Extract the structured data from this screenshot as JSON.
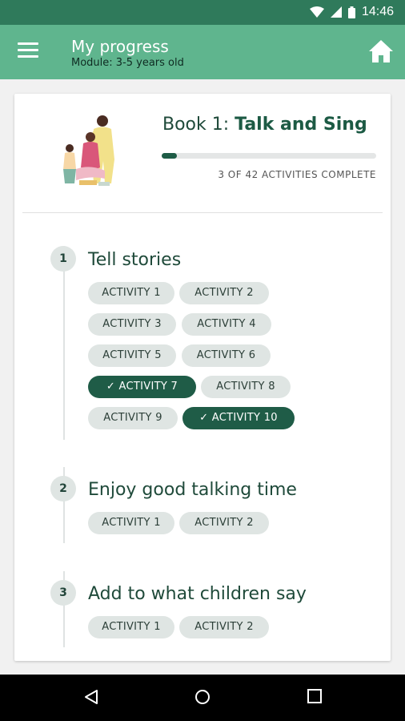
{
  "status_bar": {
    "time": "14:46"
  },
  "app_bar": {
    "title": "My progress",
    "subtitle": "Module: 3-5 years old"
  },
  "book": {
    "title_prefix": "Book 1:",
    "title_name": "Talk and Sing",
    "progress_text": "3 OF 42 ACTIVITIES COMPLETE",
    "progress_fraction": 0.071
  },
  "sections": [
    {
      "number": "1",
      "title": "Tell stories",
      "activities": [
        {
          "label": "ACTIVITY 1",
          "done": false
        },
        {
          "label": "ACTIVITY 2",
          "done": false
        },
        {
          "label": "ACTIVITY 3",
          "done": false
        },
        {
          "label": "ACTIVITY 4",
          "done": false
        },
        {
          "label": "ACTIVITY 5",
          "done": false
        },
        {
          "label": "ACTIVITY 6",
          "done": false
        },
        {
          "label": "ACTIVITY 7",
          "done": true
        },
        {
          "label": "ACTIVITY 8",
          "done": false
        },
        {
          "label": "ACTIVITY 9",
          "done": false
        },
        {
          "label": "ACTIVITY 10",
          "done": true
        }
      ]
    },
    {
      "number": "2",
      "title": "Enjoy good talking time",
      "activities": [
        {
          "label": "ACTIVITY 1",
          "done": false
        },
        {
          "label": "ACTIVITY 2",
          "done": false
        }
      ]
    },
    {
      "number": "3",
      "title": "Add to what children say",
      "activities": [
        {
          "label": "ACTIVITY 1",
          "done": false
        },
        {
          "label": "ACTIVITY 2",
          "done": false
        }
      ]
    }
  ],
  "colors": {
    "status_bar": "#2f7a5b",
    "app_bar": "#5fb58e",
    "done_chip": "#1f5c47",
    "chip": "#dfe5e3"
  }
}
